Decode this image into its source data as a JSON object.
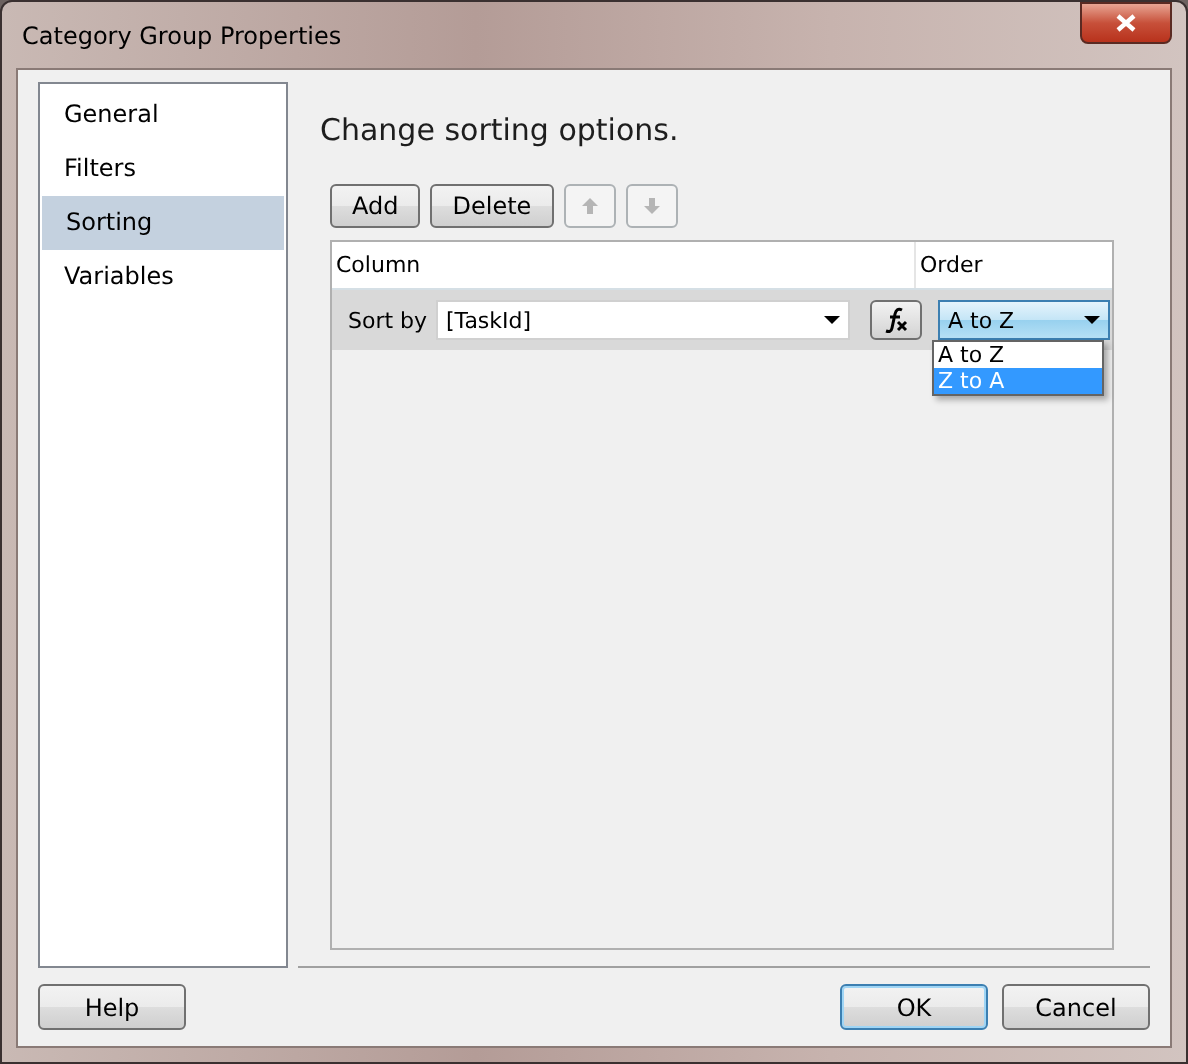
{
  "window": {
    "title": "Category Group Properties"
  },
  "sidebar": {
    "items": [
      {
        "label": "General",
        "selected": false
      },
      {
        "label": "Filters",
        "selected": false
      },
      {
        "label": "Sorting",
        "selected": true
      },
      {
        "label": "Variables",
        "selected": false
      }
    ]
  },
  "heading": "Change sorting options.",
  "toolbar": [
    {
      "kind": "text",
      "label": "Add",
      "disabled": false
    },
    {
      "kind": "text",
      "label": "Delete",
      "disabled": false
    },
    {
      "kind": "up",
      "disabled": true
    },
    {
      "kind": "down",
      "disabled": true
    }
  ],
  "grid": {
    "columns": [
      "Column",
      "Order"
    ],
    "rows": [
      {
        "label": "Sort by",
        "column_value": "[TaskId]",
        "order_value": "A to Z",
        "order_open": true,
        "order_options": [
          {
            "label": "A to Z",
            "selected": false
          },
          {
            "label": "Z to A",
            "selected": true
          }
        ]
      }
    ]
  },
  "footer": {
    "left": [
      {
        "label": "Help",
        "default": false
      }
    ],
    "right": [
      {
        "label": "OK",
        "default": true
      },
      {
        "label": "Cancel",
        "default": false
      }
    ]
  }
}
